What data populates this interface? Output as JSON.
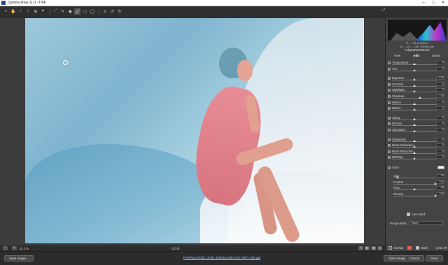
{
  "window": {
    "title": "Camera Raw 11.0  -  TIFF"
  },
  "toolbar": {
    "tools": [
      {
        "name": "zoom-icon",
        "glyph": "⌕"
      },
      {
        "name": "hand-icon",
        "glyph": "✋"
      },
      {
        "name": "white-balance-icon",
        "glyph": "⁄"
      },
      {
        "name": "color-sampler-icon",
        "glyph": "⁄"
      },
      {
        "name": "target-adjust-icon",
        "glyph": "⊕"
      },
      {
        "name": "crop-icon",
        "glyph": "⌗"
      },
      {
        "name": "straighten-icon",
        "glyph": "⟋"
      },
      {
        "name": "spot-removal-icon",
        "glyph": "✎"
      },
      {
        "name": "red-eye-icon",
        "glyph": "◉"
      },
      {
        "name": "adjustment-brush-icon",
        "glyph": "🖌"
      },
      {
        "name": "graduated-filter-icon",
        "glyph": "▭"
      },
      {
        "name": "radial-filter-icon",
        "glyph": "◯"
      },
      {
        "name": "preferences-icon",
        "glyph": "≡"
      },
      {
        "name": "rotate-left-icon",
        "glyph": "↺"
      },
      {
        "name": "rotate-right-icon",
        "glyph": "↻"
      }
    ],
    "fullscreen_glyph": "⤢"
  },
  "statusbar": {
    "zoom": "51.1%",
    "filename": "GD.tif",
    "view_glyphs": [
      "Y",
      "◧",
      "◨",
      "⊡"
    ]
  },
  "bottombar": {
    "save_label": "Save Image...",
    "workflow_link": "ProPhoto RGB; 16 bit; 4000 by 2667 (10.7MP); 300 ppi",
    "open_label": "Open Image",
    "cancel_label": "Cancel",
    "done_label": "Done"
  },
  "panel": {
    "readout_line1": "R: ---   f/1.8   1/250 s",
    "readout_line2": "G: ---   B: ---   ISO 100   85 mm",
    "adjustment_title": "Adjustment Brush",
    "modes": [
      "New",
      "Add",
      "Erase"
    ],
    "selected_mode": "Add",
    "sliders": [
      {
        "key": "temperature",
        "label": "Temperature",
        "value": "0",
        "pos": 0.5
      },
      {
        "key": "tint",
        "label": "Tint",
        "value": "0",
        "pos": 0.5
      },
      {
        "key": "exposure",
        "label": "Exposure",
        "value": "0.00",
        "pos": 0.5
      },
      {
        "key": "contrast",
        "label": "Contrast",
        "value": "0",
        "pos": 0.5
      },
      {
        "key": "highlights",
        "label": "Highlights",
        "value": "0",
        "pos": 0.5
      },
      {
        "key": "shadows",
        "label": "Shadows",
        "value": "+23",
        "pos": 0.62
      },
      {
        "key": "whites",
        "label": "Whites",
        "value": "0",
        "pos": 0.5
      },
      {
        "key": "blacks",
        "label": "Blacks",
        "value": "0",
        "pos": 0.5
      },
      {
        "key": "clarity",
        "label": "Clarity",
        "value": "0",
        "pos": 0.5
      },
      {
        "key": "dehaze",
        "label": "Dehaze",
        "value": "0",
        "pos": 0.5
      },
      {
        "key": "saturation",
        "label": "Saturation",
        "value": "0",
        "pos": 0.5
      },
      {
        "key": "sharpness",
        "label": "Sharpness",
        "value": "0",
        "pos": 0.5
      },
      {
        "key": "noise_reduction",
        "label": "Noise Reduction",
        "value": "0",
        "pos": 0.5
      },
      {
        "key": "moire_reduction",
        "label": "Moire Reduction",
        "value": "0",
        "pos": 0.5
      },
      {
        "key": "defringe",
        "label": "Defringe",
        "value": "0",
        "pos": 0.5
      }
    ],
    "color_label": "Color",
    "brush": [
      {
        "key": "size",
        "label": "Size",
        "value": "10",
        "pos": 0.1
      },
      {
        "key": "feather",
        "label": "Feather",
        "value": "100",
        "pos": 1.0
      },
      {
        "key": "flow",
        "label": "Flow",
        "value": "50",
        "pos": 0.5
      },
      {
        "key": "density",
        "label": "Density",
        "value": "100",
        "pos": 1.0
      }
    ],
    "auto_mask_label": "Auto Mask",
    "auto_mask_checked": true,
    "range_mask_label": "Range Mask:",
    "range_mask_value": "None",
    "overlay_label": "Overlay",
    "mask_label": "Mask",
    "clear_all_label": "Clear All"
  },
  "colors": {
    "panel_bg": "#444444",
    "app_bg": "#3a3a3a",
    "mask_swatch": "#e1634c"
  }
}
